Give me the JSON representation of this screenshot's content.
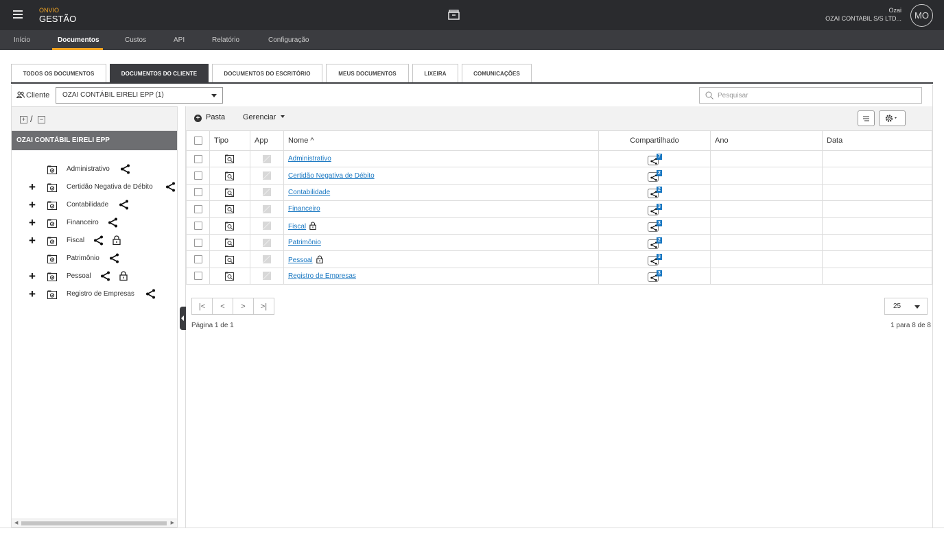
{
  "header": {
    "brand_small": "ONVIO",
    "brand_big": "GESTÃO",
    "user_name": "Ozai",
    "user_company": "OZAI CONTABIL S/S LTD...",
    "avatar_initials": "MO"
  },
  "nav": {
    "items": [
      {
        "label": "Início"
      },
      {
        "label": "Documentos"
      },
      {
        "label": "Custos"
      },
      {
        "label": "API"
      },
      {
        "label": "Relatório"
      },
      {
        "label": "Configuração"
      }
    ],
    "active": "Documentos"
  },
  "tabs": [
    {
      "label": "TODOS OS DOCUMENTOS"
    },
    {
      "label": "DOCUMENTOS DO CLIENTE"
    },
    {
      "label": "DOCUMENTOS DO ESCRITÓRIO"
    },
    {
      "label": "MEUS DOCUMENTOS"
    },
    {
      "label": "LIXEIRA"
    },
    {
      "label": "COMUNICAÇÕES"
    }
  ],
  "filter": {
    "client_label": "Cliente",
    "client_value": "OZAI CONTÁBIL EIRELI EPP (1)",
    "search_placeholder": "Pesquisar"
  },
  "tree": {
    "slash": "/",
    "root": "OZAI CONTÁBIL EIRELI EPP",
    "items": [
      {
        "label": "Administrativo",
        "expandable": false,
        "locked": false
      },
      {
        "label": "Certidão Negativa de Débito",
        "expandable": true,
        "locked": false
      },
      {
        "label": "Contabilidade",
        "expandable": true,
        "locked": false
      },
      {
        "label": "Financeiro",
        "expandable": true,
        "locked": false
      },
      {
        "label": "Fiscal",
        "expandable": true,
        "locked": true
      },
      {
        "label": "Patrimônio",
        "expandable": false,
        "locked": false
      },
      {
        "label": "Pessoal",
        "expandable": true,
        "locked": true
      },
      {
        "label": "Registro de Empresas",
        "expandable": true,
        "locked": false
      }
    ]
  },
  "toolbar": {
    "pasta_label": "Pasta",
    "gerenciar_label": "Gerenciar"
  },
  "table": {
    "columns": {
      "tipo": "Tipo",
      "app": "App",
      "nome": "Nome ^",
      "compartilhado": "Compartilhado",
      "ano": "Ano",
      "data": "Data"
    },
    "rows": [
      {
        "name": "Administrativo",
        "shared": "7",
        "locked": false,
        "ano": "",
        "data": ""
      },
      {
        "name": "Certidão Negativa de Débito",
        "shared": "2",
        "locked": false,
        "ano": "",
        "data": ""
      },
      {
        "name": "Contabilidade",
        "shared": "2",
        "locked": false,
        "ano": "",
        "data": ""
      },
      {
        "name": "Financeiro",
        "shared": "3",
        "locked": false,
        "ano": "",
        "data": ""
      },
      {
        "name": "Fiscal",
        "shared": "3",
        "locked": true,
        "ano": "",
        "data": ""
      },
      {
        "name": "Patrimônio",
        "shared": "2",
        "locked": false,
        "ano": "",
        "data": ""
      },
      {
        "name": "Pessoal",
        "shared": "3",
        "locked": true,
        "ano": "",
        "data": ""
      },
      {
        "name": "Registro de Empresas",
        "shared": "3",
        "locked": false,
        "ano": "",
        "data": ""
      }
    ]
  },
  "pagination": {
    "first": "|<",
    "prev": "<",
    "next": ">",
    "last": ">|",
    "page_info": "Página 1 de 1",
    "per_page": "25",
    "range_info": "1 para 8 de 8"
  },
  "colors": {
    "header_bg": "#2a2b2e",
    "nav_bg": "#3b3c40",
    "accent": "#f5a623",
    "link": "#1a78c2"
  }
}
